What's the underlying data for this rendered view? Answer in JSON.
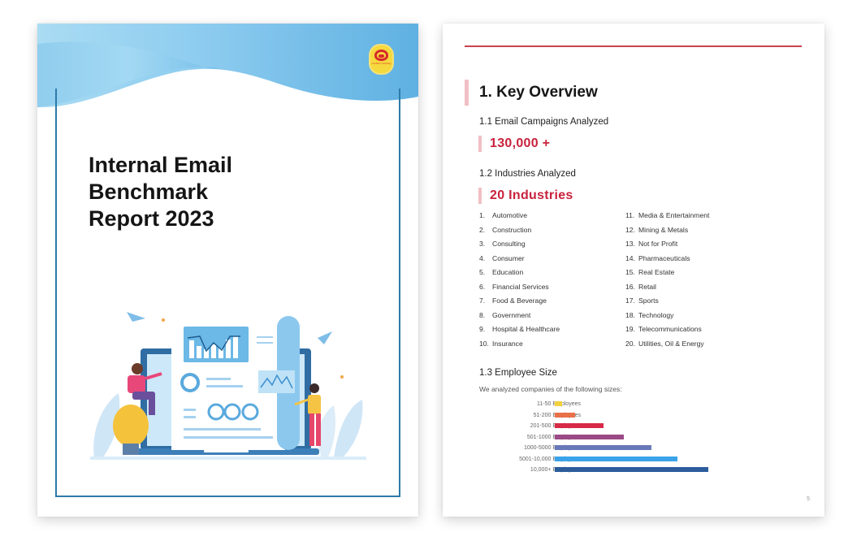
{
  "cover": {
    "title_lines": [
      "Internal Email",
      "Benchmark",
      "Report 2023"
    ],
    "logo_text": "contact monkey",
    "colors": {
      "wave_light": "#aadcf3",
      "wave_dark": "#5fb1e2",
      "frame": "#2d7aa8",
      "logo_bg": "#f6d93d",
      "logo_fg": "#d72b2b"
    }
  },
  "inner": {
    "section_title": "1. Key Overview",
    "campaigns": {
      "heading": "1.1 Email Campaigns Analyzed",
      "value": "130,000 +"
    },
    "industries": {
      "heading": "1.2 Industries Analyzed",
      "value": "20 Industries",
      "list": [
        {
          "num": "1.",
          "name": "Automotive"
        },
        {
          "num": "2.",
          "name": "Construction"
        },
        {
          "num": "3.",
          "name": "Consulting"
        },
        {
          "num": "4.",
          "name": "Consumer"
        },
        {
          "num": "5.",
          "name": "Education"
        },
        {
          "num": "6.",
          "name": "Financial Services"
        },
        {
          "num": "7.",
          "name": "Food & Beverage"
        },
        {
          "num": "8.",
          "name": "Government"
        },
        {
          "num": "9.",
          "name": "Hospital & Healthcare"
        },
        {
          "num": "10.",
          "name": "Insurance"
        },
        {
          "num": "11.",
          "name": "Media & Entertainment"
        },
        {
          "num": "12.",
          "name": "Mining & Metals"
        },
        {
          "num": "13.",
          "name": "Not for Profit"
        },
        {
          "num": "14.",
          "name": "Pharmaceuticals"
        },
        {
          "num": "15.",
          "name": "Real Estate"
        },
        {
          "num": "16.",
          "name": "Retail"
        },
        {
          "num": "17.",
          "name": "Sports"
        },
        {
          "num": "18.",
          "name": "Technology"
        },
        {
          "num": "19.",
          "name": "Telecommunications"
        },
        {
          "num": "20.",
          "name": "Utilities, Oil & Energy"
        }
      ]
    },
    "employee_size": {
      "heading": "1.3 Employee Size",
      "note": "We analyzed companies of the following sizes:"
    },
    "page_number": "5",
    "colors": {
      "accent": "#c8223c",
      "rule": "#c9424f",
      "marker": "#f1bfc5"
    }
  },
  "chart_data": {
    "type": "bar",
    "orientation": "horizontal",
    "title": "1.3 Employee Size",
    "xlabel": "",
    "ylabel": "",
    "categories": [
      "11-50 Employees",
      "51-200 Employees",
      "201-500 Employees",
      "501-1000 Employees",
      "1000-5000 Employees",
      "5001-10,000 Employees",
      "10,000+ Employees"
    ],
    "values": [
      5,
      13,
      32,
      45,
      63,
      80,
      100
    ],
    "value_unit": "relative length (largest = 100), no axis shown",
    "colors": [
      "#f2d23c",
      "#e9714a",
      "#d72a48",
      "#9b4a87",
      "#6878b8",
      "#3aa3ea",
      "#2b5d9c"
    ],
    "xlim": [
      0,
      100
    ],
    "grid": false,
    "legend": "none"
  }
}
